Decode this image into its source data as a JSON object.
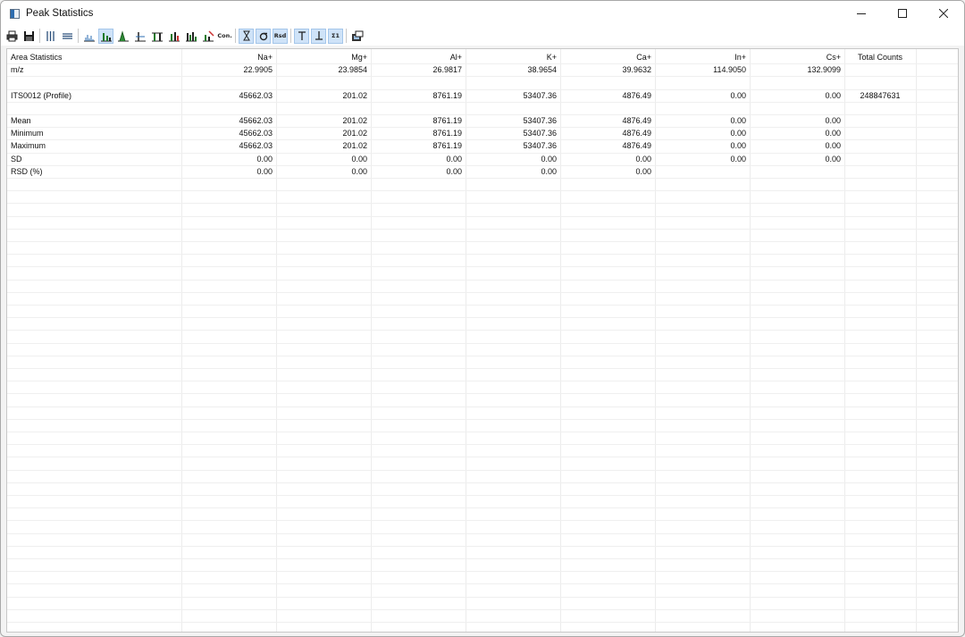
{
  "window": {
    "title": "Peak Statistics"
  },
  "toolbar": {
    "buttons": [
      {
        "icon": "print-icon"
      },
      {
        "icon": "save-icon"
      },
      {
        "icon": "columns-icon"
      },
      {
        "icon": "rows-icon"
      },
      {
        "icon": "spectrum-icon"
      },
      {
        "icon": "peak-area-icon"
      },
      {
        "icon": "peak-icon"
      },
      {
        "icon": "peak-height-icon"
      },
      {
        "icon": "peak-width-icon"
      },
      {
        "icon": "peak-range-icon"
      },
      {
        "icon": "peak-multi-icon"
      },
      {
        "icon": "peak-edit-icon"
      },
      {
        "label": "Con."
      },
      {
        "icon": "time-icon"
      },
      {
        "icon": "sigma-lower-icon"
      },
      {
        "label": "Rsd"
      },
      {
        "icon": "max-icon"
      },
      {
        "icon": "min-icon"
      },
      {
        "label": "Σ1"
      },
      {
        "icon": "export-icon"
      }
    ]
  },
  "table": {
    "header": [
      "Area Statistics",
      "Na+",
      "Mg+",
      "Al+",
      "K+",
      "Ca+",
      "In+",
      "Cs+",
      "Total Counts"
    ],
    "mz": [
      "m/z",
      "22.9905",
      "23.9854",
      "26.9817",
      "38.9654",
      "39.9632",
      "114.9050",
      "132.9099",
      ""
    ],
    "sample": [
      "ITS0012 (Profile)",
      "45662.03",
      "201.02",
      "8761.19",
      "53407.36",
      "4876.49",
      "0.00",
      "0.00",
      "248847631"
    ],
    "stats": [
      [
        "Mean",
        "45662.03",
        "201.02",
        "8761.19",
        "53407.36",
        "4876.49",
        "0.00",
        "0.00",
        ""
      ],
      [
        "Minimum",
        "45662.03",
        "201.02",
        "8761.19",
        "53407.36",
        "4876.49",
        "0.00",
        "0.00",
        ""
      ],
      [
        "Maximum",
        "45662.03",
        "201.02",
        "8761.19",
        "53407.36",
        "4876.49",
        "0.00",
        "0.00",
        ""
      ],
      [
        "SD",
        "0.00",
        "0.00",
        "0.00",
        "0.00",
        "0.00",
        "0.00",
        "0.00",
        ""
      ],
      [
        "RSD (%)",
        "0.00",
        "0.00",
        "0.00",
        "0.00",
        "0.00",
        "",
        "",
        ""
      ]
    ]
  }
}
